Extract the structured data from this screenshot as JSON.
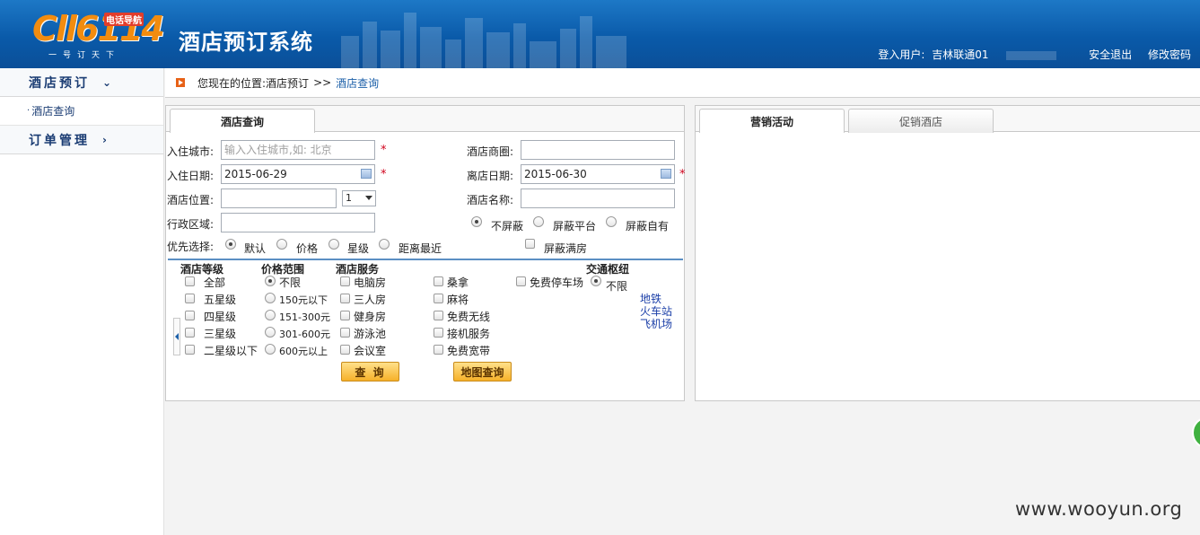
{
  "header": {
    "logo_number": "114",
    "logo_prefix": "Cll6",
    "logo_tag": "电话导航",
    "logo_slogan": "一号订天下",
    "system_title": "酒店预订系统",
    "login_label": "登入用户:",
    "login_user": "吉林联通01",
    "logout": "安全退出",
    "change_password": "修改密码"
  },
  "nav": {
    "groups": [
      {
        "label": "酒店预订",
        "chevron": "⌄",
        "items": [
          "酒店查询"
        ]
      },
      {
        "label": "订单管理",
        "chevron": "›",
        "items": []
      }
    ]
  },
  "breadcrumb": {
    "prefix": "您现在的位置:",
    "level1": "酒店预订",
    "separator": ">>",
    "current": "酒店查询"
  },
  "search": {
    "tab": "酒店查询",
    "checkin_city_label": "入住城市:",
    "checkin_city_placeholder": "输入入住城市,如: 北京",
    "business_area_label": "酒店商圈:",
    "checkin_date_label": "入住日期:",
    "checkin_date_value": "2015-06-29",
    "checkout_date_label": "离店日期:",
    "checkout_date_value": "2015-06-30",
    "location_label": "酒店位置:",
    "distance_select": "1",
    "hotel_name_label": "酒店名称:",
    "district_label": "行政区域:",
    "filter_options": [
      "不屏蔽",
      "屏蔽平台",
      "屏蔽自有"
    ],
    "priority_label": "优先选择:",
    "priority_options": [
      "默认",
      "价格",
      "星级",
      "距离最近"
    ],
    "hide_full_label": "屏蔽满房",
    "required_mark": "*",
    "hotel_level": {
      "title": "酒店等级",
      "options": [
        "全部",
        "五星级",
        "四星级",
        "三星级",
        "二星级以下"
      ]
    },
    "price_range": {
      "title": "价格范围",
      "options": [
        "不限",
        "150元以下",
        "151-300元",
        "301-600元",
        "600元以上"
      ]
    },
    "hotel_services": {
      "title": "酒店服务",
      "col1": [
        "电脑房",
        "三人房",
        "健身房",
        "游泳池",
        "会议室"
      ],
      "col2": [
        "桑拿",
        "麻将",
        "免费无线",
        "接机服务",
        "免费宽带"
      ],
      "col3": [
        "免费停车场"
      ]
    },
    "transport": {
      "title": "交通枢纽",
      "default": "不限",
      "links": [
        "地铁",
        "火车站",
        "飞机场"
      ]
    },
    "query_button": "查 询",
    "map_query_button": "地图查询"
  },
  "promo": {
    "tabs": [
      "营销活动",
      "促销酒店"
    ]
  },
  "watermark": "www.wooyun.org",
  "colors": {
    "header_blue": "#0a5aa9",
    "nav_text": "#1a3c73",
    "button_orange": "#f6b12a",
    "required_red": "#d0021b"
  }
}
